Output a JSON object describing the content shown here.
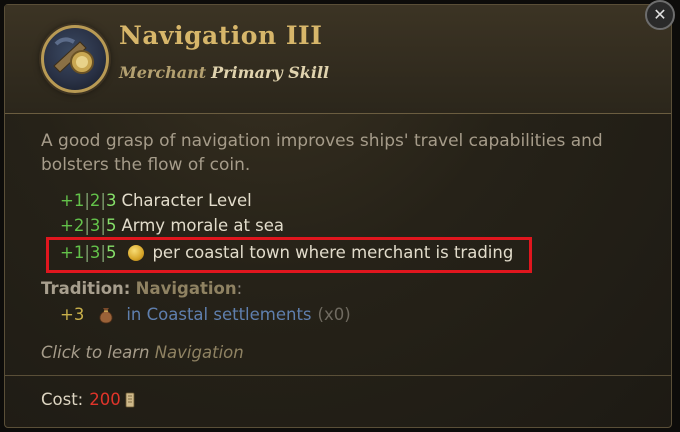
{
  "skill": {
    "title": "Navigation III",
    "class": "Merchant",
    "type": "Primary Skill",
    "icon": "navigation-skill-icon",
    "description": "A good grasp of navigation improves ships' travel capabilities and bolsters the flow of coin."
  },
  "close_icon": "close-icon",
  "bonuses": [
    {
      "v1": "+1",
      "v2": "2",
      "v3": "3",
      "label": "Character Level"
    },
    {
      "v1": "+2",
      "v2": "3",
      "v3": "5",
      "label": "Army morale at sea"
    },
    {
      "v1": "+1",
      "v2": "3",
      "v3": "5",
      "icon": "gold-coin-icon",
      "label": "per coastal town where merchant is trading",
      "highlighted": true
    }
  ],
  "tradition": {
    "label": "Tradition:",
    "name": "Navigation",
    "colon": ":",
    "bonus": "+3",
    "icon": "money-bag-icon",
    "condition": "in Coastal settlements",
    "count": "(x0)"
  },
  "learn": {
    "prefix": "Click to learn",
    "skill": "Navigation"
  },
  "cost": {
    "label": "Cost:",
    "value": "200",
    "icon": "scroll-icon"
  },
  "colors": {
    "title": "#d7b66a",
    "bonus_green": "#63c24a",
    "highlight_green": "#86e06a",
    "cost_red": "#e0342a",
    "highlight_box": "#e0161e",
    "tradition_link": "#5f7fae"
  }
}
